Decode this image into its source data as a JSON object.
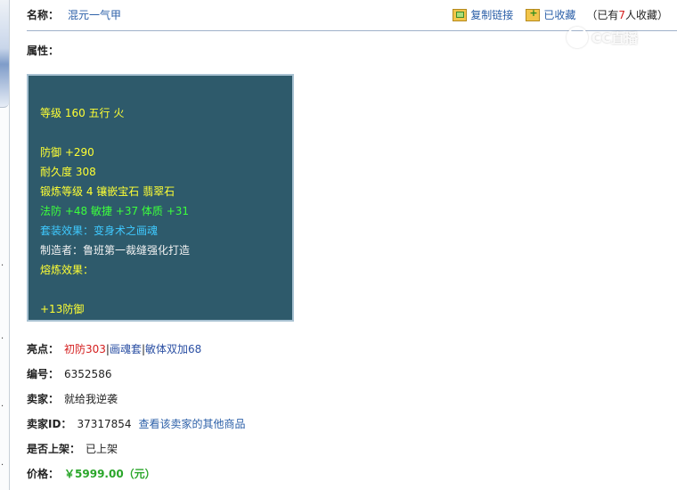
{
  "header": {
    "name_label": "名称：",
    "item_name": "混元一气甲",
    "copy_link": "复制链接",
    "favorited": "已收藏",
    "fav_prefix": "（已有",
    "fav_count": "7",
    "fav_suffix": "人收藏）"
  },
  "watermark": {
    "text": "CC直播"
  },
  "attributes": {
    "label": "属性：",
    "lines": {
      "level": "等级 160 五行 火",
      "defense": "防御 +290",
      "durability": "耐久度 308",
      "forge": "锻炼等级 4 镶嵌宝石 翡翠石",
      "stats": "法防 +48 敏捷 +37 体质 +31",
      "set_effect": "套装效果：变身术之画魂",
      "maker": "制造者：鲁班第一裁缝强化打造",
      "smelt": "熔炼效果：",
      "smelt_value": "+13防御"
    }
  },
  "highlights": {
    "label": "亮点：",
    "item1": "初防303",
    "sep": "|",
    "item2": "画魂套",
    "item3": "敏体双加68"
  },
  "serial": {
    "label": "编号：",
    "value": "6352586"
  },
  "seller": {
    "label": "卖家：",
    "value": "就给我逆袭"
  },
  "seller_id": {
    "label": "卖家ID：",
    "value": "37317854",
    "link": "查看该卖家的其他商品"
  },
  "listed": {
    "label": "是否上架：",
    "value": "已上架"
  },
  "price": {
    "label": "价格：",
    "value": "￥5999.00（元）"
  },
  "colors": {
    "panel_bg": "#2e5a6b",
    "yellow_text": "#ffff33",
    "green_text": "#3cff3c",
    "cyan_text": "#3fc9ff",
    "link_blue": "#2b5fa8",
    "highlight_red": "#d41e1e",
    "price_green": "#2aa62a"
  },
  "icons": {
    "copy": "copy-link-icon",
    "favorite": "favorite-add-icon",
    "watermark": "cc-logo-icon"
  }
}
